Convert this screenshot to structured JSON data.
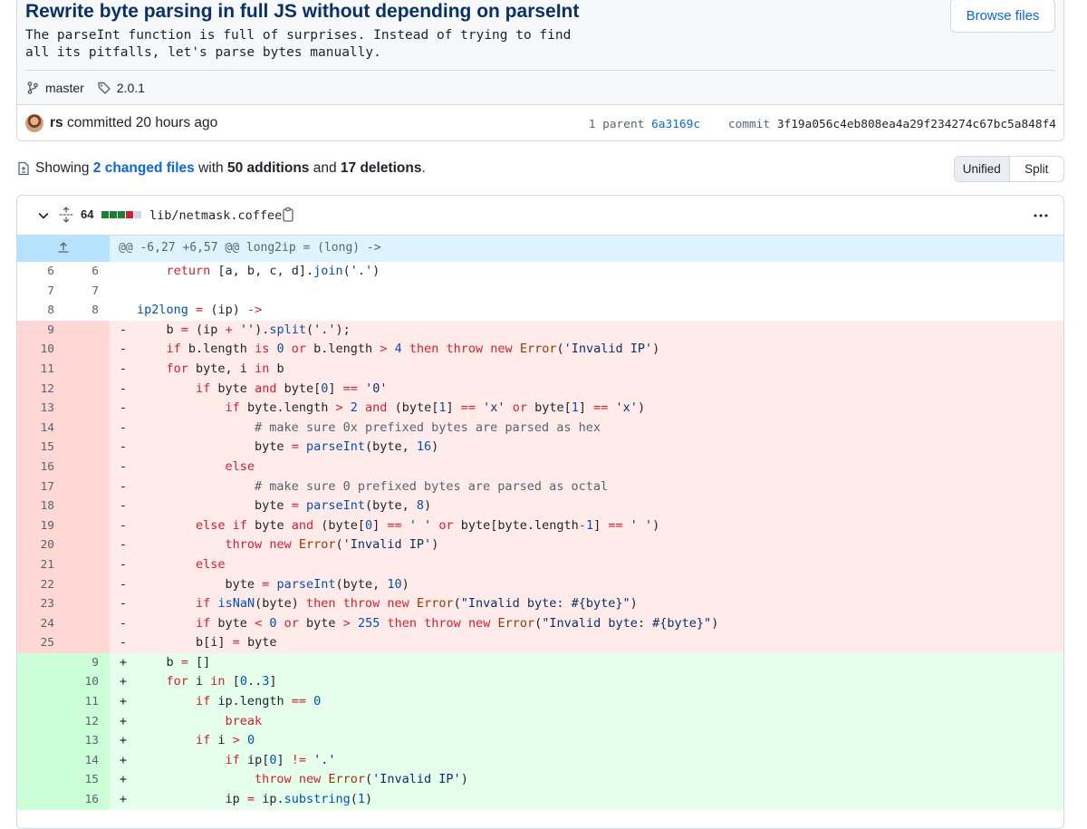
{
  "commit": {
    "title": "Rewrite byte parsing in full JS without depending on parseInt",
    "description": "The parseInt function is full of surprises. Instead of trying to find\nall its pitfalls, let's parse bytes manually.",
    "browse_label": "Browse files",
    "branch": "master",
    "tag": "2.0.1",
    "author": "rs",
    "committed_text": "committed 20 hours ago",
    "parent_label": "1 parent",
    "parent_sha": "6a3169c",
    "commit_label": "commit",
    "commit_sha": "3f19a056c4eb808ea4a29f234274c67bc5a848f4"
  },
  "summary": {
    "showing": "Showing",
    "changed_files": "2 changed files",
    "with": "with",
    "additions": "50 additions",
    "and": "and",
    "deletions": "17 deletions",
    "period": "."
  },
  "view_toggle": {
    "unified": "Unified",
    "split": "Split"
  },
  "file": {
    "changes": "64",
    "name": "lib/netmask.coffee",
    "hunk_header": "@@ -6,27 +6,57 @@ long2ip = (long) ->"
  },
  "colors": {
    "accent": "#0969da",
    "added": "#1a7f37",
    "deleted": "#cf222e"
  }
}
